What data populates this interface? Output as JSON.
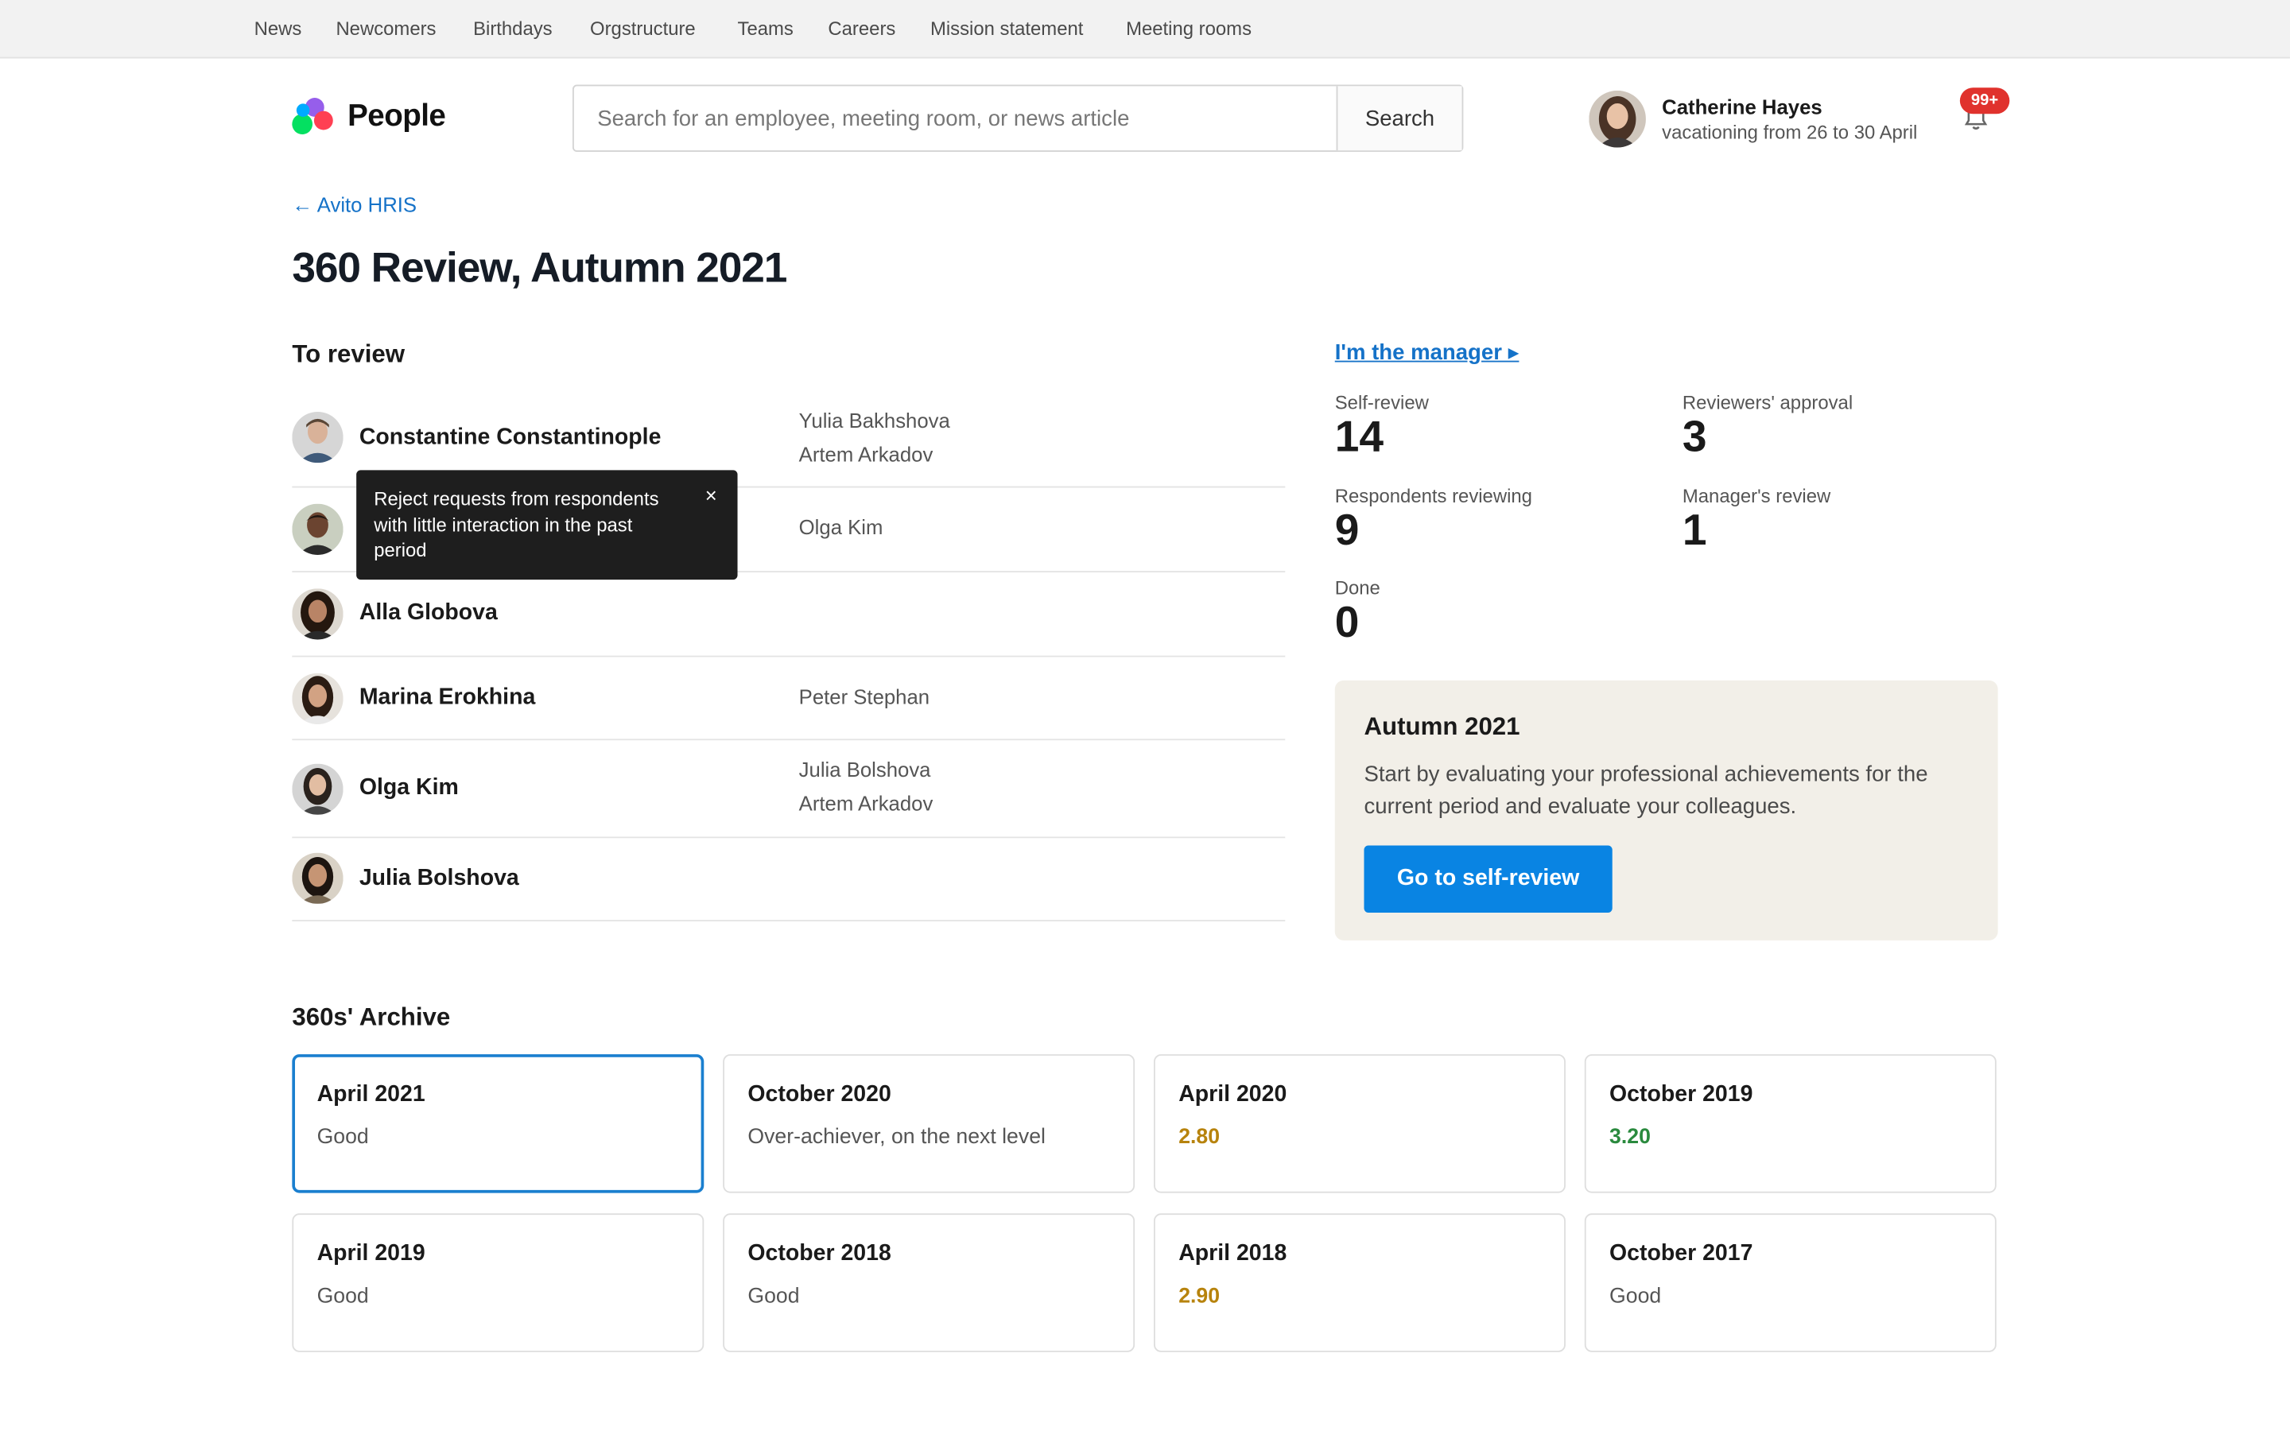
{
  "top_nav": [
    "News",
    "Newcomers",
    "Birthdays",
    "Orgstructure",
    "Teams",
    "Careers",
    "Mission statement",
    "Meeting rooms"
  ],
  "logo": {
    "text": "People"
  },
  "search": {
    "placeholder": "Search for an employee, meeting room, or news article",
    "button_label": "Search"
  },
  "user": {
    "name": "Catherine Hayes",
    "status": "vacationing from 26 to 30 April",
    "notification_count": "99+"
  },
  "breadcrumb": {
    "back_label": "← Avito HRIS"
  },
  "page_title": "360 Review, Autumn 2021",
  "to_review": {
    "title": "To review",
    "people": [
      {
        "name": "Constantine Constantinople",
        "respondents": [
          "Yulia Bakhshova",
          "Artem Arkadov"
        ]
      },
      {
        "name": "",
        "respondents": [
          "Olga Kim"
        ]
      },
      {
        "name": "Alla Globova",
        "respondents": []
      },
      {
        "name": "Marina Erokhina",
        "respondents": [
          "Peter Stephan"
        ]
      },
      {
        "name": "Olga Kim",
        "respondents": [
          "Julia Bolshova",
          "Artem Arkadov"
        ]
      },
      {
        "name": "Julia Bolshova",
        "respondents": []
      }
    ]
  },
  "tooltip": {
    "text": "Reject requests from respondents with little interaction in the past period",
    "close": "×"
  },
  "manager": {
    "label": "I'm the manager ▸",
    "stats": [
      {
        "label": "Self-review",
        "value": "14"
      },
      {
        "label": "Reviewers' approval",
        "value": "3"
      },
      {
        "label": "Respondents reviewing",
        "value": "9"
      },
      {
        "label": "Manager's review",
        "value": "1"
      },
      {
        "label": "Done",
        "value": "0"
      }
    ]
  },
  "promo": {
    "title": "Autumn 2021",
    "description": "Start by evaluating your professional achievements for the current period and evaluate your colleagues.",
    "button_label": "Go to self-review"
  },
  "archive": {
    "title": "360s' Archive",
    "cards": [
      {
        "title": "April 2021",
        "value": "Good"
      },
      {
        "title": "October 2020",
        "value": "Over-achiever, on the next level"
      },
      {
        "title": "April 2020",
        "value": "2.80"
      },
      {
        "title": "October 2019",
        "value": "3.20"
      },
      {
        "title": "April 2019",
        "value": "Good"
      },
      {
        "title": "October 2018",
        "value": "Good"
      },
      {
        "title": "April 2018",
        "value": "2.90"
      },
      {
        "title": "October 2017",
        "value": "Good"
      }
    ]
  },
  "colors": {
    "accent": "#1572c8",
    "button": "#0984e3",
    "badge": "#e0322d",
    "score_low": "#b7830d",
    "score_high": "#2a8a3e",
    "promo_bg": "#f2efe8"
  }
}
